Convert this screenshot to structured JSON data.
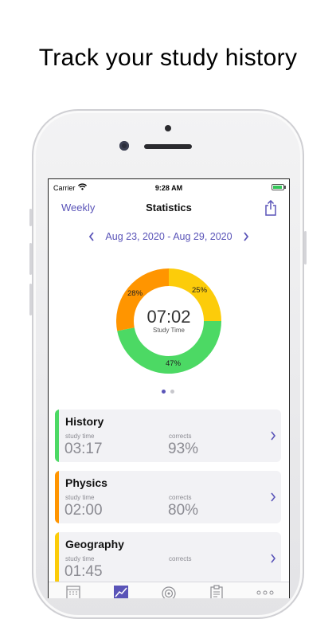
{
  "headline": "Track your study history",
  "status_bar": {
    "carrier": "Carrier",
    "time": "9:28 AM"
  },
  "nav": {
    "left_label": "Weekly",
    "title": "Statistics"
  },
  "date_range": {
    "text": "Aug 23, 2020 - Aug 29, 2020"
  },
  "donut": {
    "center_value": "07:02",
    "center_label": "Study Time",
    "segments": [
      {
        "label": "25%",
        "value": 25,
        "color": "#fccc0a"
      },
      {
        "label": "47%",
        "value": 47,
        "color": "#4cd964"
      },
      {
        "label": "28%",
        "value": 28,
        "color": "#ff9500"
      }
    ]
  },
  "pager": {
    "count": 2,
    "active": 0,
    "active_color": "#5a54b8",
    "inactive_color": "#c7c7cc"
  },
  "subjects": [
    {
      "name": "History",
      "time_label": "study time",
      "time": "03:17",
      "corrects_label": "corrects",
      "corrects": "93%",
      "color": "#4cd964"
    },
    {
      "name": "Physics",
      "time_label": "study time",
      "time": "02:00",
      "corrects_label": "corrects",
      "corrects": "80%",
      "color": "#ff9500"
    },
    {
      "name": "Geography",
      "time_label": "study time",
      "time": "01:45",
      "corrects_label": "corrects",
      "corrects": "",
      "color": "#fccc0a"
    }
  ],
  "tabs": [
    {
      "icon": "calendar-icon"
    },
    {
      "icon": "chart-icon",
      "active": true
    },
    {
      "icon": "target-icon"
    },
    {
      "icon": "clipboard-icon"
    },
    {
      "icon": "more-icon"
    }
  ],
  "colors": {
    "accent": "#5a54b8"
  }
}
